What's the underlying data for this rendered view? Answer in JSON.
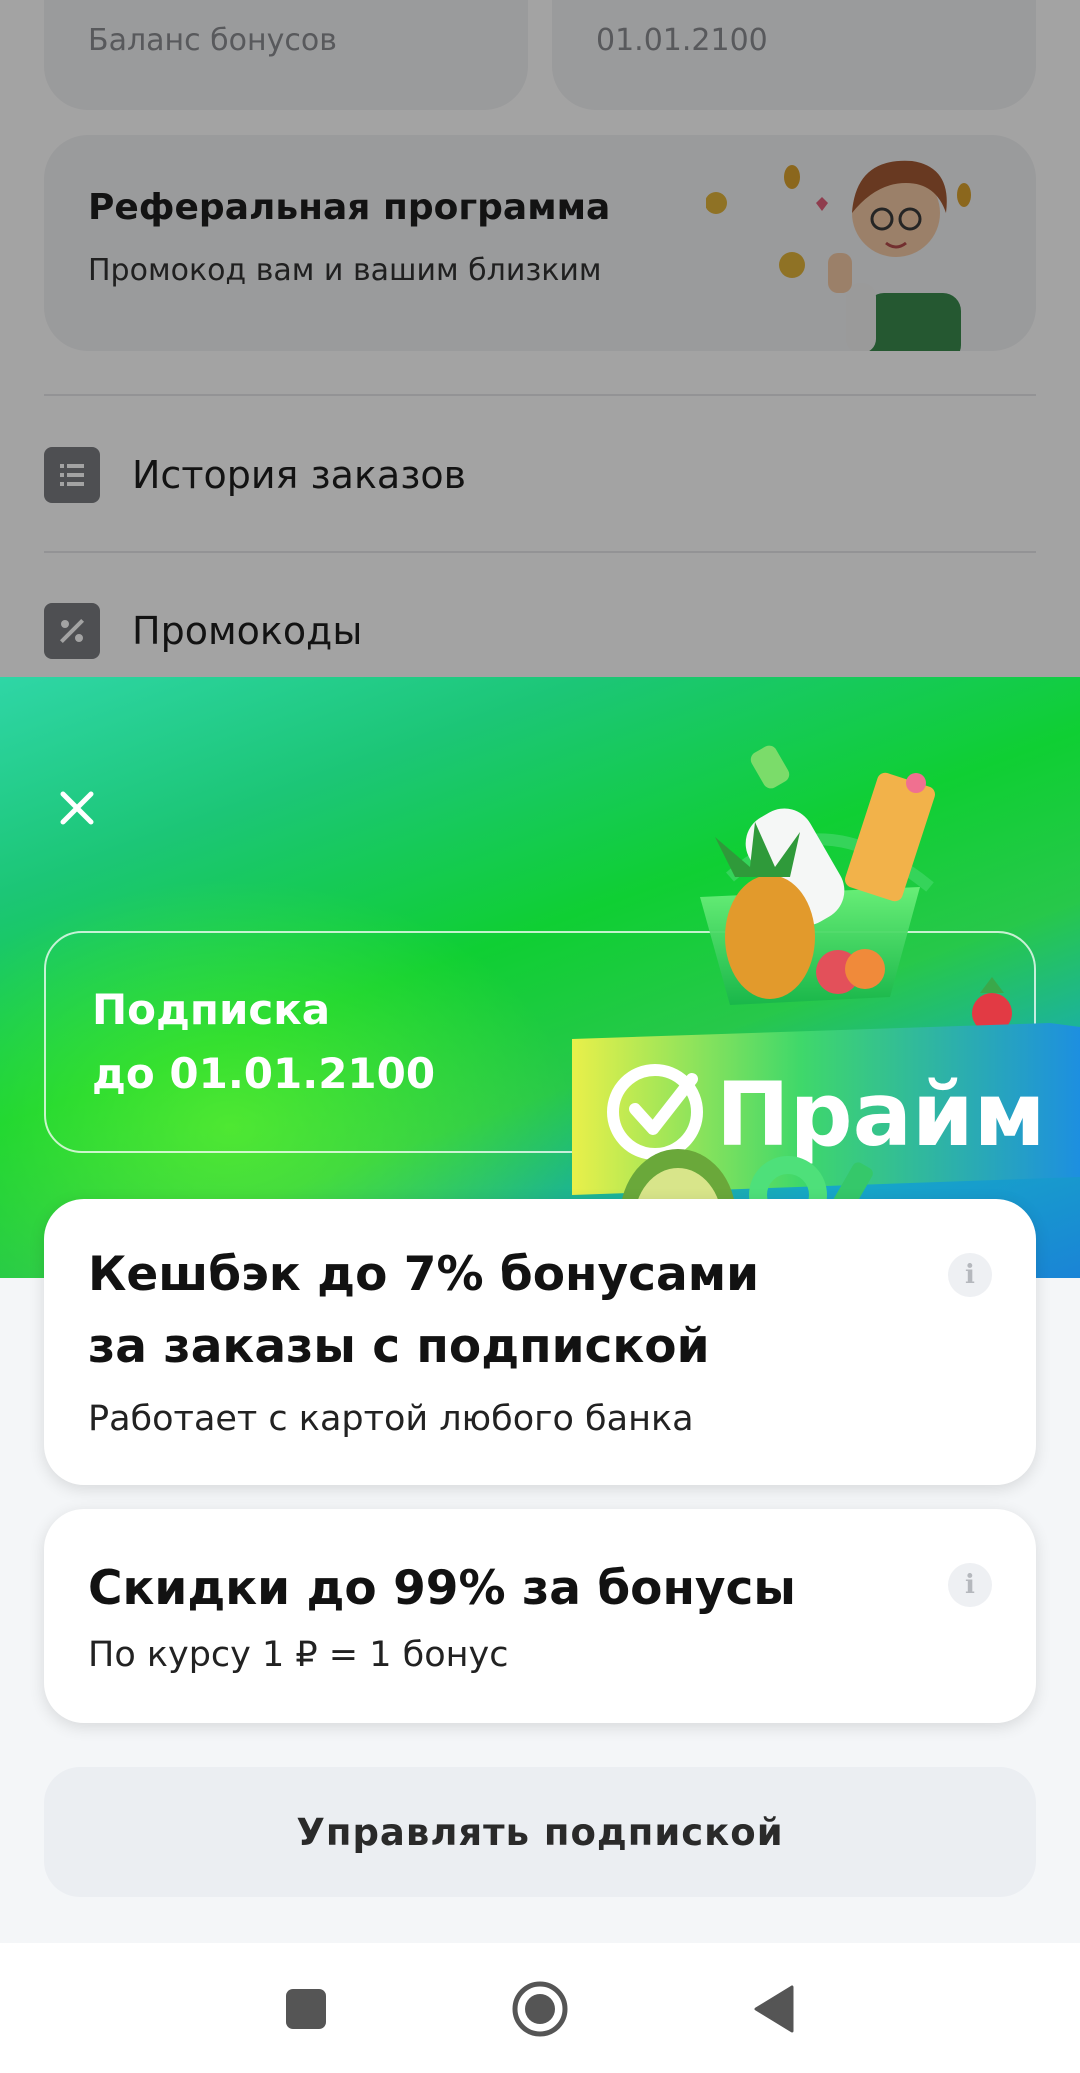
{
  "background": {
    "bonus_label": "Баланс бонусов",
    "expiry_date": "01.01.2100",
    "referral": {
      "title": "Реферальная программа",
      "subtitle": "Промокод вам и вашим близким"
    },
    "menu": [
      {
        "label": "История заказов",
        "icon": "list-icon"
      },
      {
        "label": "Промокоды",
        "icon": "percent-icon"
      }
    ]
  },
  "sheet": {
    "subscription_line1": "Подписка",
    "subscription_line2": "до 01.01.2100",
    "brand_logo_text": "Прайм",
    "cards": [
      {
        "title_line1": "Кешбэк до 7% бонусами",
        "title_line2": "за заказы с подпиской",
        "subtitle": "Работает с картой любого банка"
      },
      {
        "title": "Скидки до 99% за бонусы",
        "subtitle": "По курсу 1 ₽ = 1 бонус"
      }
    ],
    "manage_button": "Управлять подпиской",
    "info_glyph": "i"
  },
  "colors": {
    "accent_green": "#0fcf33",
    "accent_blue": "#1a84d6",
    "card_bg": "#ffffff",
    "sheet_bg": "#f4f6f8"
  }
}
